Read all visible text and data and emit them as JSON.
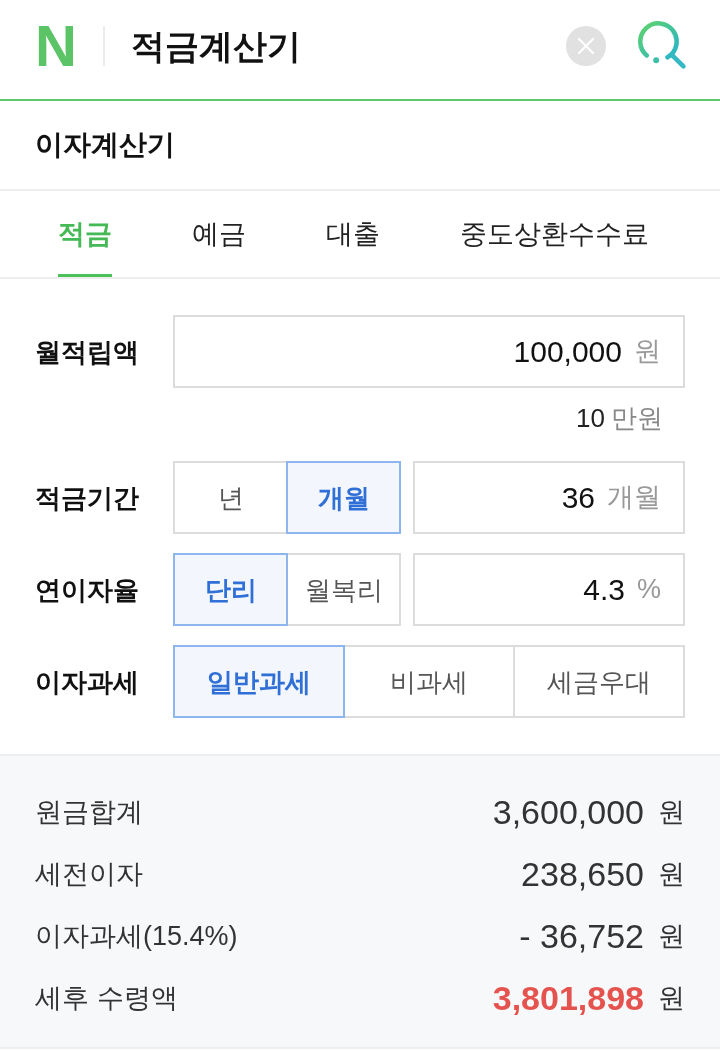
{
  "header": {
    "logo": "N",
    "title": "적금계산기"
  },
  "section": {
    "title": "이자계산기"
  },
  "tabs": [
    {
      "label": "적금",
      "selected": true
    },
    {
      "label": "예금",
      "selected": false
    },
    {
      "label": "대출",
      "selected": false
    },
    {
      "label": "중도상환수수료",
      "selected": false
    }
  ],
  "form": [
    {
      "kind": "input",
      "label": "월적립액",
      "value": "100,000",
      "unit": "원",
      "hint": {
        "value": "10",
        "unit": "만원"
      }
    },
    {
      "kind": "toggle_input",
      "label": "적금기간",
      "options": [
        {
          "label": "년",
          "selected": false
        },
        {
          "label": "개월",
          "selected": true
        }
      ],
      "value": "36",
      "unit": "개월"
    },
    {
      "kind": "toggle_input",
      "label": "연이자율",
      "options": [
        {
          "label": "단리",
          "selected": true
        },
        {
          "label": "월복리",
          "selected": false
        }
      ],
      "value": "4.3",
      "unit": "%"
    },
    {
      "kind": "toggle",
      "label": "이자과세",
      "options": [
        {
          "label": "일반과세",
          "selected": true
        },
        {
          "label": "비과세",
          "selected": false
        },
        {
          "label": "세금우대",
          "selected": false
        }
      ]
    }
  ],
  "results": [
    {
      "label": "원금합계",
      "value": "3,600,000",
      "unit": "원",
      "highlight": false
    },
    {
      "label": "세전이자",
      "value": "238,650",
      "unit": "원",
      "highlight": false
    },
    {
      "label": "이자과세(15.4%)",
      "value": "- 36,752",
      "unit": "원",
      "highlight": false
    },
    {
      "label": "세후 수령액",
      "value": "3,801,898",
      "unit": "원",
      "highlight": true
    }
  ]
}
